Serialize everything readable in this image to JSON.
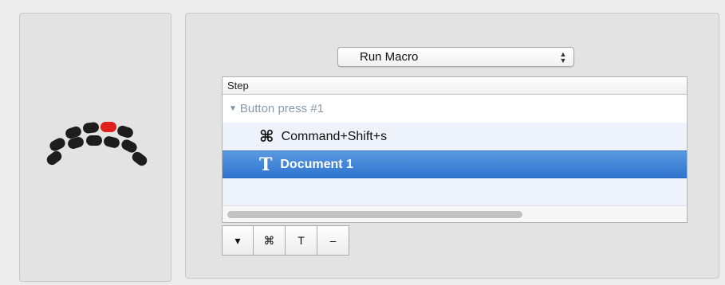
{
  "action_select": {
    "value": "Run Macro",
    "arrows_icon": "updown-chevrons-icon"
  },
  "table": {
    "column_header": "Step",
    "group": {
      "label": "Button press #1",
      "expanded": true
    },
    "rows": [
      {
        "icon": "command-key-icon",
        "glyph": "⌘",
        "label": "Command+Shift+s",
        "selected": false
      },
      {
        "icon": "text-tool-icon",
        "glyph": "T",
        "label": "Document 1",
        "selected": true
      }
    ]
  },
  "toolbar": {
    "dropdown_glyph": "▾",
    "command_glyph": "⌘",
    "text_glyph": "T",
    "remove_glyph": "–"
  },
  "colors": {
    "selection": "#3b82db",
    "active_key": "#e01f1f",
    "inactive_key": "#1d1d1d"
  }
}
